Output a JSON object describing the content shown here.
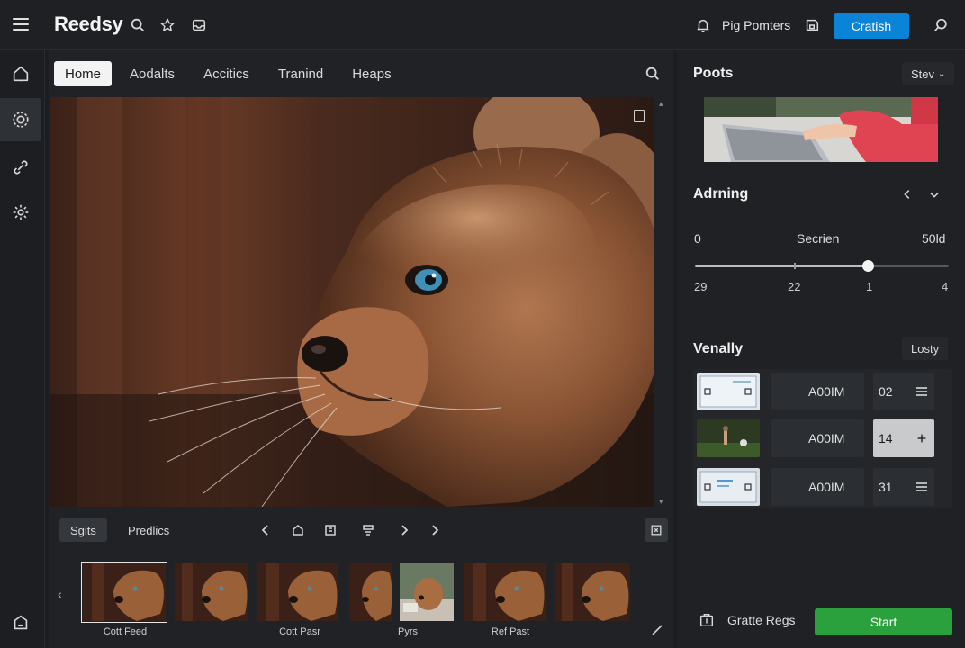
{
  "app": {
    "title": "Reedsy"
  },
  "header": {
    "pm_label": "Pig Pomters",
    "create_label": "Cratish",
    "icons": [
      "menu-icon",
      "search-icon",
      "star-icon",
      "inbox-icon",
      "bell-icon",
      "save-icon",
      "search-icon"
    ]
  },
  "tabs": [
    {
      "label": "Home",
      "active": true
    },
    {
      "label": "Aodalts",
      "active": false
    },
    {
      "label": "Accitics",
      "active": false
    },
    {
      "label": "Tranind",
      "active": false
    },
    {
      "label": "Heaps",
      "active": false
    }
  ],
  "viewer": {
    "toolbar": {
      "chip_active": "Sgits",
      "chip_other": "Predlics"
    }
  },
  "filmstrip": {
    "labels": [
      "Cott Feed",
      "Cott Pasr",
      "Pyrs",
      "Ref Past"
    ]
  },
  "right": {
    "posts": {
      "title": "Poots",
      "dropdown": "Stev"
    },
    "admin": {
      "title": "Adrning",
      "left_value": "0",
      "center_label": "Secrien",
      "right_value": "50ld",
      "ticks": [
        "29",
        "22",
        "1",
        "4"
      ],
      "slider_value_fraction": 0.68
    },
    "variants": {
      "title": "Venally",
      "dropdown": "Losty",
      "rows": [
        {
          "dot": "•",
          "code": "A00IM",
          "num": "02",
          "action": "list-icon",
          "highlight": false
        },
        {
          "dot": "•",
          "code": "A00IM",
          "num": "14",
          "action": "plus-icon",
          "highlight": true
        },
        {
          "dot": "•",
          "code": "A00IM",
          "num": "31",
          "action": "list-icon",
          "highlight": false
        }
      ]
    },
    "footer": {
      "create_label": "Gratte Regs",
      "start_label": "Start"
    }
  },
  "colors": {
    "accent": "#0a84d6",
    "start": "#2aa13c",
    "background": "#1b1d20"
  }
}
